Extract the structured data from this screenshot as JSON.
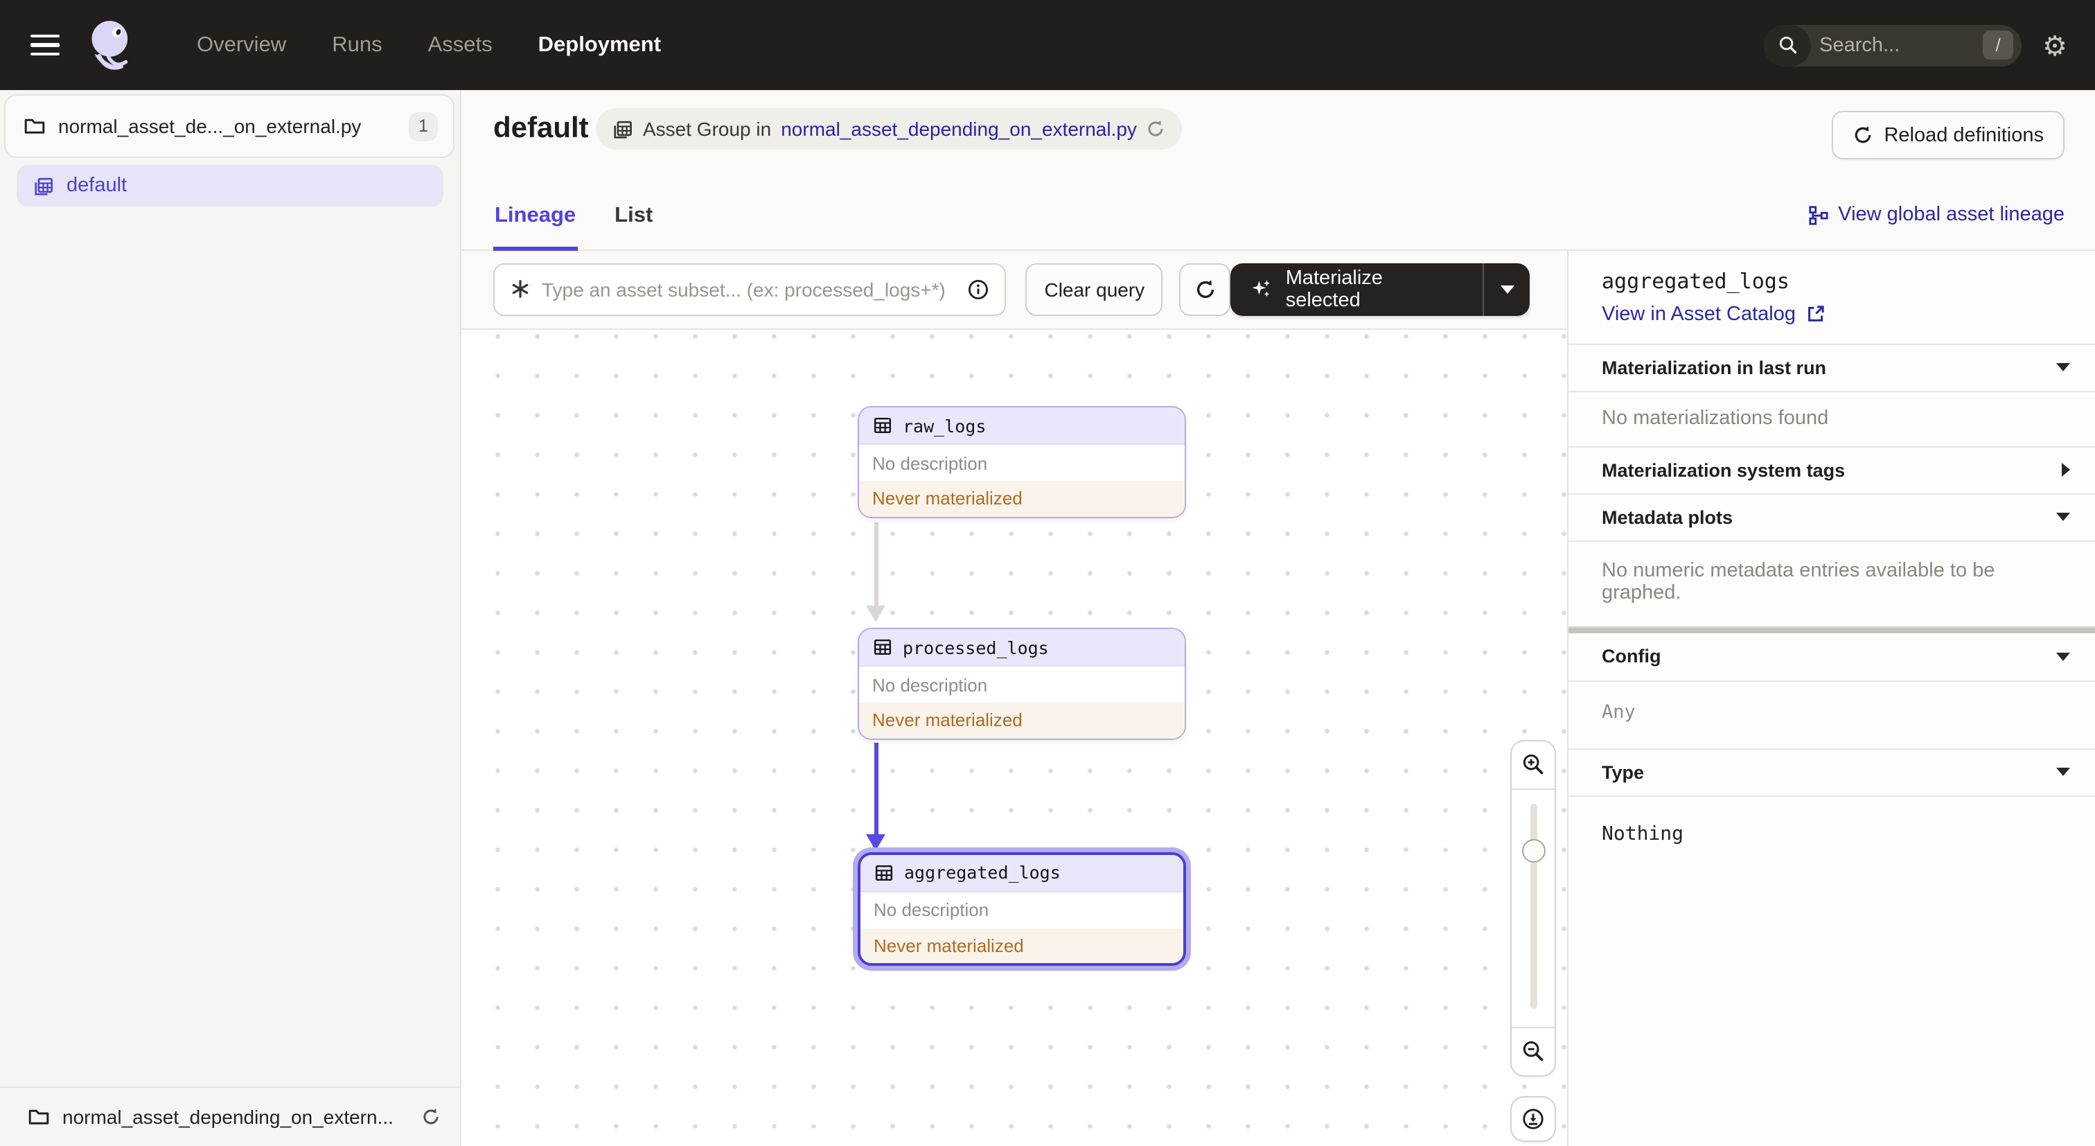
{
  "topnav": {
    "menu_items": [
      {
        "label": "Overview",
        "active": false
      },
      {
        "label": "Runs",
        "active": false
      },
      {
        "label": "Assets",
        "active": false
      },
      {
        "label": "Deployment",
        "active": true
      }
    ],
    "search_placeholder": "Search...",
    "search_shortcut": "/"
  },
  "sidebar": {
    "code_location": "normal_asset_de..._on_external.py",
    "code_location_badge": "1",
    "group_label": "default",
    "footer_location": "normal_asset_depending_on_extern..."
  },
  "header": {
    "title": "default",
    "breadcrumb_prefix": "Asset Group in",
    "breadcrumb_link": "normal_asset_depending_on_external.py",
    "reload_button": "Reload definitions"
  },
  "tabs": {
    "lineage": "Lineage",
    "list": "List",
    "global_link": "View global asset lineage"
  },
  "toolbar": {
    "query_placeholder": "Type an asset subset... (ex: processed_logs+*)",
    "clear_button": "Clear query",
    "materialize_button": "Materialize selected"
  },
  "graph": {
    "nodes": [
      {
        "name": "raw_logs",
        "description": "No description",
        "status": "Never materialized",
        "selected": false
      },
      {
        "name": "processed_logs",
        "description": "No description",
        "status": "Never materialized",
        "selected": false
      },
      {
        "name": "aggregated_logs",
        "description": "No description",
        "status": "Never materialized",
        "selected": true
      }
    ],
    "edges": [
      {
        "from": "raw_logs",
        "to": "processed_logs"
      },
      {
        "from": "processed_logs",
        "to": "aggregated_logs"
      }
    ]
  },
  "panel": {
    "asset_name": "aggregated_logs",
    "catalog_link": "View in Asset Catalog",
    "sections": {
      "materialization": {
        "title": "Materialization in last run",
        "state": "expanded",
        "empty": "No materializations found"
      },
      "system_tags": {
        "title": "Materialization system tags",
        "state": "collapsed"
      },
      "metadata_plots": {
        "title": "Metadata plots",
        "state": "expanded",
        "empty": "No numeric metadata entries available to be graphed."
      },
      "config": {
        "title": "Config",
        "state": "expanded",
        "value": "Any"
      },
      "type": {
        "title": "Type",
        "state": "expanded",
        "value": "Nothing"
      }
    }
  },
  "colors": {
    "topnav_bg": "#221E1B",
    "accent_blurple": "#4F43DD",
    "link_navy": "#2B27A5",
    "node_border": "#B3ACE9",
    "node_header_bg": "#E9E7F9",
    "warning_text": "#AE6B23",
    "warning_bg": "#FAF3E9",
    "edge_blue": "#554BE4"
  }
}
